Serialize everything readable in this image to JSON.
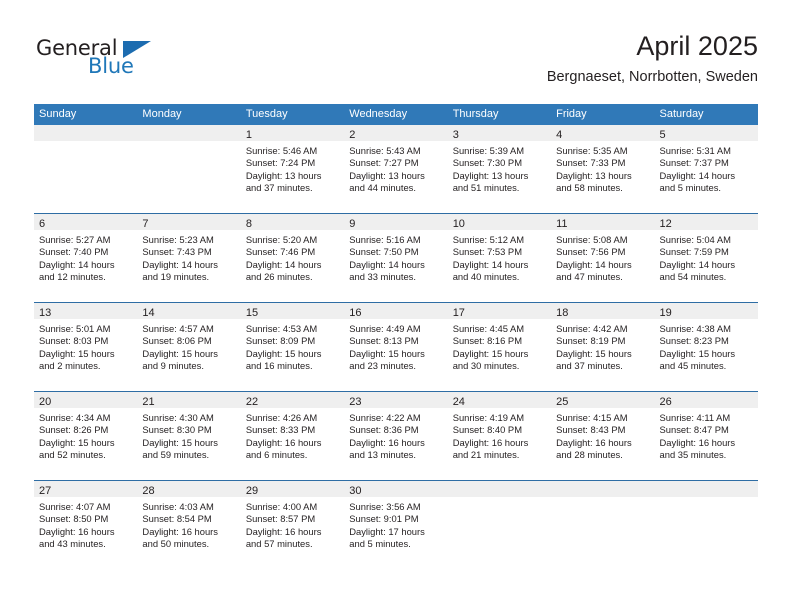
{
  "brand": {
    "name_part1": "General",
    "name_part2": "Blue",
    "triangle_icon": "triangle-icon",
    "accent_color": "#1c6cb0"
  },
  "header": {
    "month_title": "April 2025",
    "location": "Bergnaeset, Norrbotten, Sweden"
  },
  "calendar": {
    "header_bg": "#3079b8",
    "row_separator_color": "#2e6da4",
    "day_band_bg": "#efefef",
    "weekday_names": [
      "Sunday",
      "Monday",
      "Tuesday",
      "Wednesday",
      "Thursday",
      "Friday",
      "Saturday"
    ],
    "weeks": [
      [
        {
          "day": "",
          "lines": []
        },
        {
          "day": "",
          "lines": []
        },
        {
          "day": "1",
          "lines": [
            "Sunrise: 5:46 AM",
            "Sunset: 7:24 PM",
            "Daylight: 13 hours",
            "and 37 minutes."
          ]
        },
        {
          "day": "2",
          "lines": [
            "Sunrise: 5:43 AM",
            "Sunset: 7:27 PM",
            "Daylight: 13 hours",
            "and 44 minutes."
          ]
        },
        {
          "day": "3",
          "lines": [
            "Sunrise: 5:39 AM",
            "Sunset: 7:30 PM",
            "Daylight: 13 hours",
            "and 51 minutes."
          ]
        },
        {
          "day": "4",
          "lines": [
            "Sunrise: 5:35 AM",
            "Sunset: 7:33 PM",
            "Daylight: 13 hours",
            "and 58 minutes."
          ]
        },
        {
          "day": "5",
          "lines": [
            "Sunrise: 5:31 AM",
            "Sunset: 7:37 PM",
            "Daylight: 14 hours",
            "and 5 minutes."
          ]
        }
      ],
      [
        {
          "day": "6",
          "lines": [
            "Sunrise: 5:27 AM",
            "Sunset: 7:40 PM",
            "Daylight: 14 hours",
            "and 12 minutes."
          ]
        },
        {
          "day": "7",
          "lines": [
            "Sunrise: 5:23 AM",
            "Sunset: 7:43 PM",
            "Daylight: 14 hours",
            "and 19 minutes."
          ]
        },
        {
          "day": "8",
          "lines": [
            "Sunrise: 5:20 AM",
            "Sunset: 7:46 PM",
            "Daylight: 14 hours",
            "and 26 minutes."
          ]
        },
        {
          "day": "9",
          "lines": [
            "Sunrise: 5:16 AM",
            "Sunset: 7:50 PM",
            "Daylight: 14 hours",
            "and 33 minutes."
          ]
        },
        {
          "day": "10",
          "lines": [
            "Sunrise: 5:12 AM",
            "Sunset: 7:53 PM",
            "Daylight: 14 hours",
            "and 40 minutes."
          ]
        },
        {
          "day": "11",
          "lines": [
            "Sunrise: 5:08 AM",
            "Sunset: 7:56 PM",
            "Daylight: 14 hours",
            "and 47 minutes."
          ]
        },
        {
          "day": "12",
          "lines": [
            "Sunrise: 5:04 AM",
            "Sunset: 7:59 PM",
            "Daylight: 14 hours",
            "and 54 minutes."
          ]
        }
      ],
      [
        {
          "day": "13",
          "lines": [
            "Sunrise: 5:01 AM",
            "Sunset: 8:03 PM",
            "Daylight: 15 hours",
            "and 2 minutes."
          ]
        },
        {
          "day": "14",
          "lines": [
            "Sunrise: 4:57 AM",
            "Sunset: 8:06 PM",
            "Daylight: 15 hours",
            "and 9 minutes."
          ]
        },
        {
          "day": "15",
          "lines": [
            "Sunrise: 4:53 AM",
            "Sunset: 8:09 PM",
            "Daylight: 15 hours",
            "and 16 minutes."
          ]
        },
        {
          "day": "16",
          "lines": [
            "Sunrise: 4:49 AM",
            "Sunset: 8:13 PM",
            "Daylight: 15 hours",
            "and 23 minutes."
          ]
        },
        {
          "day": "17",
          "lines": [
            "Sunrise: 4:45 AM",
            "Sunset: 8:16 PM",
            "Daylight: 15 hours",
            "and 30 minutes."
          ]
        },
        {
          "day": "18",
          "lines": [
            "Sunrise: 4:42 AM",
            "Sunset: 8:19 PM",
            "Daylight: 15 hours",
            "and 37 minutes."
          ]
        },
        {
          "day": "19",
          "lines": [
            "Sunrise: 4:38 AM",
            "Sunset: 8:23 PM",
            "Daylight: 15 hours",
            "and 45 minutes."
          ]
        }
      ],
      [
        {
          "day": "20",
          "lines": [
            "Sunrise: 4:34 AM",
            "Sunset: 8:26 PM",
            "Daylight: 15 hours",
            "and 52 minutes."
          ]
        },
        {
          "day": "21",
          "lines": [
            "Sunrise: 4:30 AM",
            "Sunset: 8:30 PM",
            "Daylight: 15 hours",
            "and 59 minutes."
          ]
        },
        {
          "day": "22",
          "lines": [
            "Sunrise: 4:26 AM",
            "Sunset: 8:33 PM",
            "Daylight: 16 hours",
            "and 6 minutes."
          ]
        },
        {
          "day": "23",
          "lines": [
            "Sunrise: 4:22 AM",
            "Sunset: 8:36 PM",
            "Daylight: 16 hours",
            "and 13 minutes."
          ]
        },
        {
          "day": "24",
          "lines": [
            "Sunrise: 4:19 AM",
            "Sunset: 8:40 PM",
            "Daylight: 16 hours",
            "and 21 minutes."
          ]
        },
        {
          "day": "25",
          "lines": [
            "Sunrise: 4:15 AM",
            "Sunset: 8:43 PM",
            "Daylight: 16 hours",
            "and 28 minutes."
          ]
        },
        {
          "day": "26",
          "lines": [
            "Sunrise: 4:11 AM",
            "Sunset: 8:47 PM",
            "Daylight: 16 hours",
            "and 35 minutes."
          ]
        }
      ],
      [
        {
          "day": "27",
          "lines": [
            "Sunrise: 4:07 AM",
            "Sunset: 8:50 PM",
            "Daylight: 16 hours",
            "and 43 minutes."
          ]
        },
        {
          "day": "28",
          "lines": [
            "Sunrise: 4:03 AM",
            "Sunset: 8:54 PM",
            "Daylight: 16 hours",
            "and 50 minutes."
          ]
        },
        {
          "day": "29",
          "lines": [
            "Sunrise: 4:00 AM",
            "Sunset: 8:57 PM",
            "Daylight: 16 hours",
            "and 57 minutes."
          ]
        },
        {
          "day": "30",
          "lines": [
            "Sunrise: 3:56 AM",
            "Sunset: 9:01 PM",
            "Daylight: 17 hours",
            "and 5 minutes."
          ]
        },
        {
          "day": "",
          "lines": []
        },
        {
          "day": "",
          "lines": []
        },
        {
          "day": "",
          "lines": []
        }
      ]
    ]
  }
}
